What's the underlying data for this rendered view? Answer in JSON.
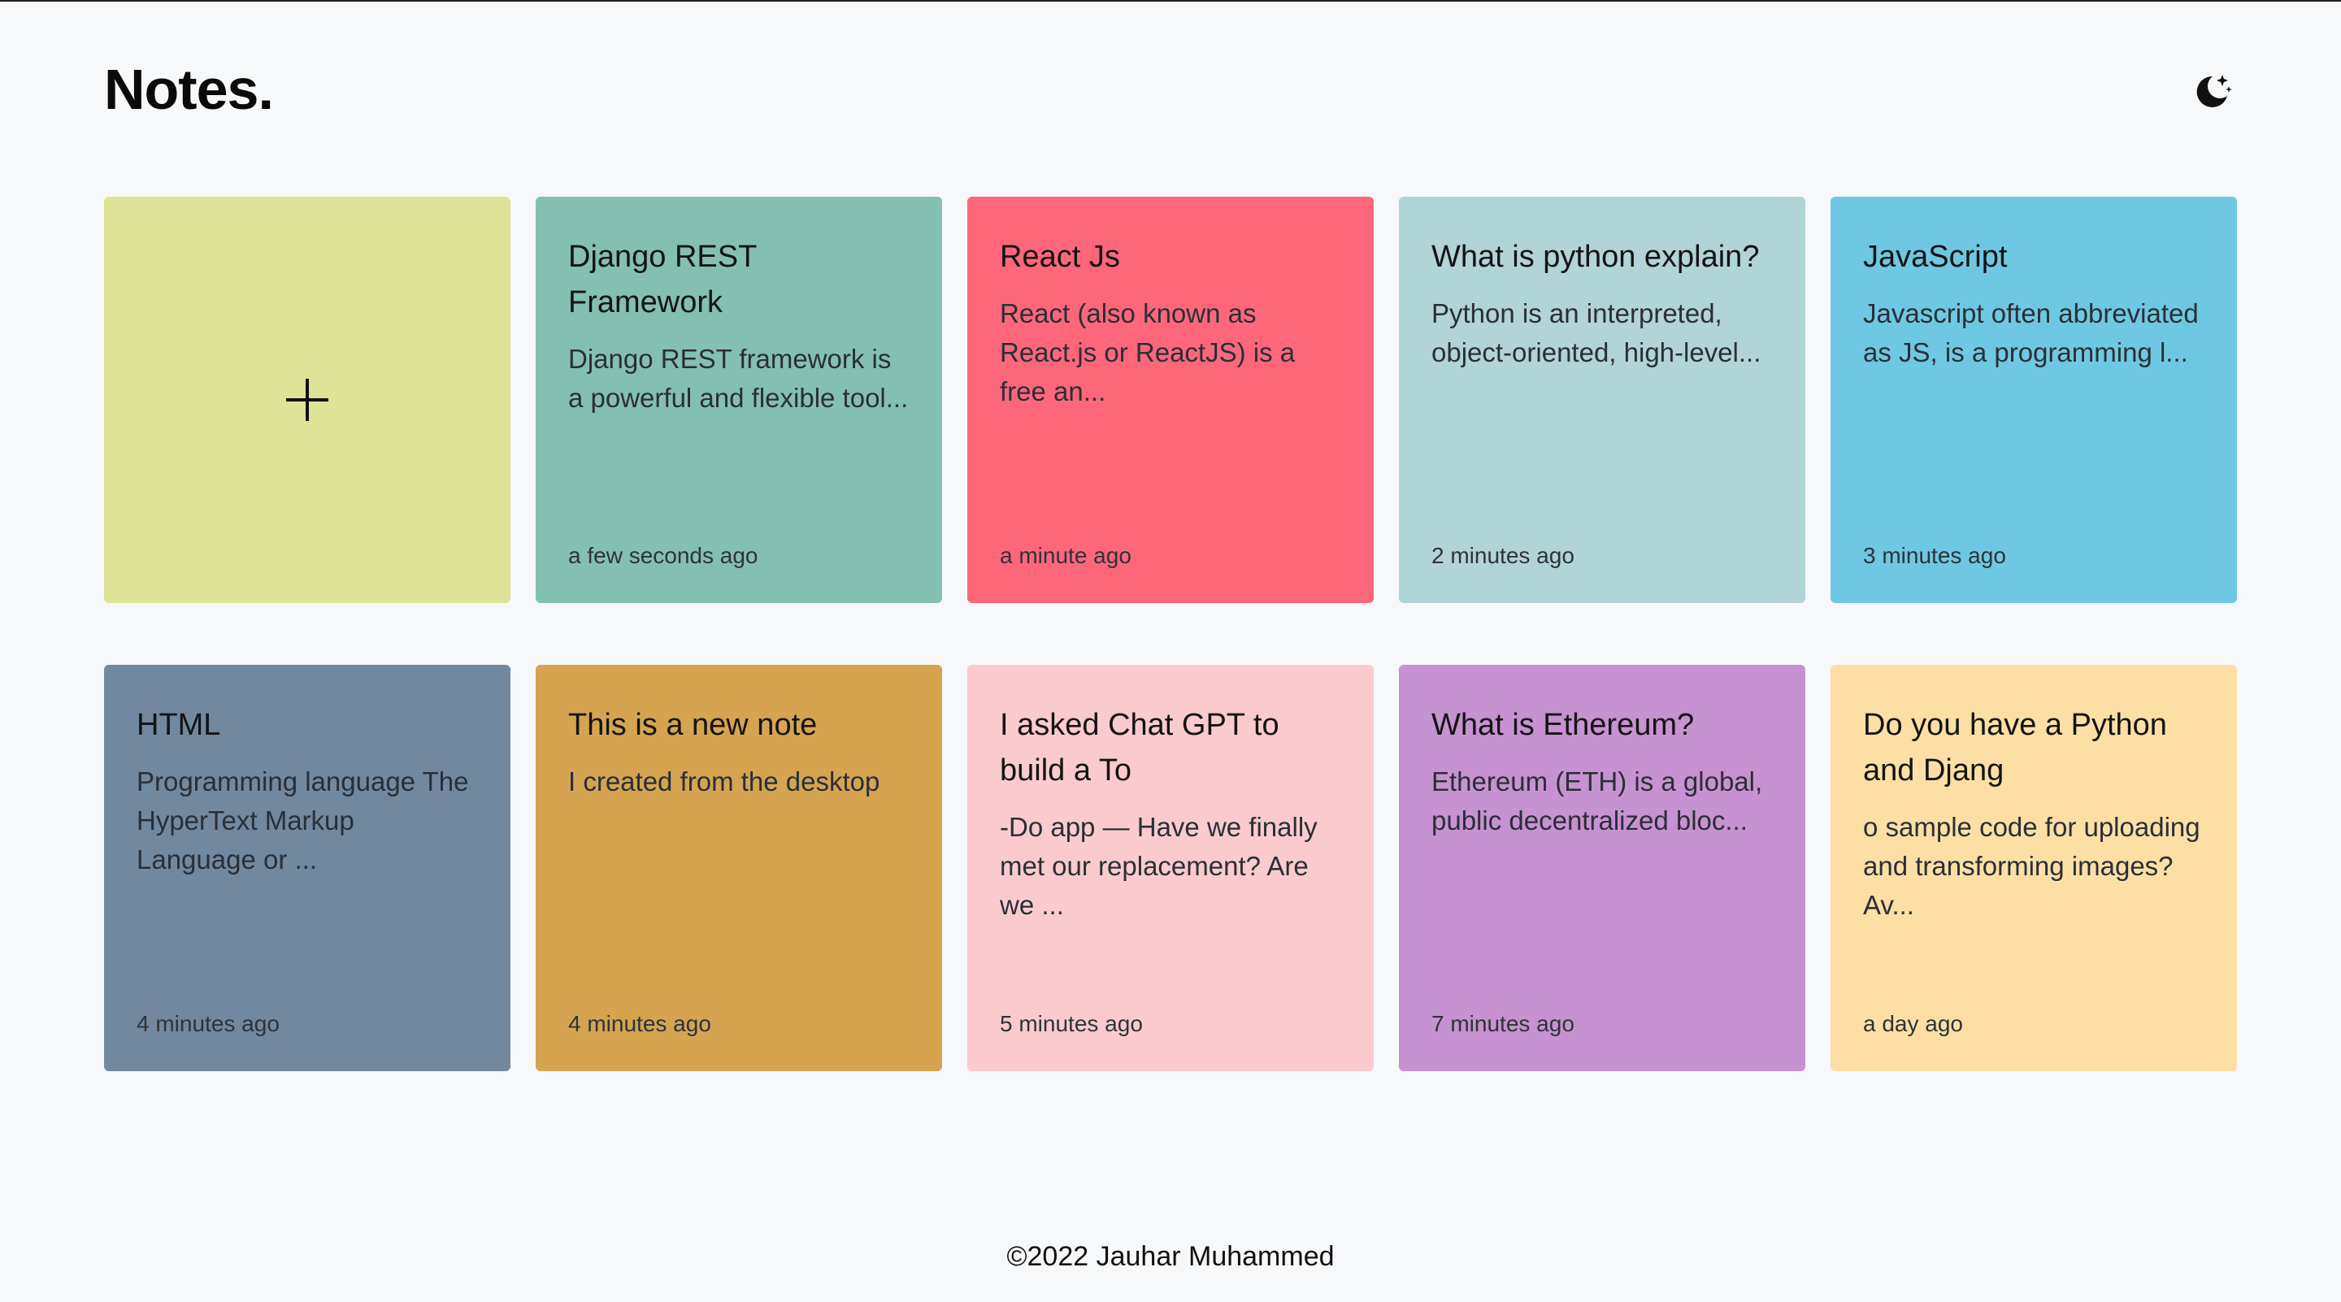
{
  "app": {
    "title": "Notes.",
    "theme_toggle_icon": "moon-stars-icon"
  },
  "add_card": {
    "icon": "plus-icon",
    "color": "#dee397"
  },
  "notes": [
    {
      "title": "Django REST Framework",
      "body": "Django REST framework is a powerful and flexible tool...",
      "time": "a few seconds ago",
      "color": "#83c0b2"
    },
    {
      "title": "React Js",
      "body": "React (also known as React.js or ReactJS) is a free an...",
      "time": "a minute ago",
      "color": "#fe6779"
    },
    {
      "title": "What is python explain?",
      "body": "Python is an interpreted, object-oriented, high-level...",
      "time": "2 minutes ago",
      "color": "#b1d4d6"
    },
    {
      "title": "JavaScript",
      "body": "Javascript often abbreviated as JS, is a programming l...",
      "time": "3 minutes ago",
      "color": "#6ec8e3"
    },
    {
      "title": "HTML",
      "body": "Programming language The HyperText Markup Language or ...",
      "time": "4 minutes ago",
      "color": "#72889f"
    },
    {
      "title": "This is a new note",
      "body": "I created from the desktop",
      "time": "4 minutes ago",
      "color": "#d6a450"
    },
    {
      "title": "I asked Chat GPT to build a To",
      "body": "-Do app — Have we finally met our replacement? Are we ...",
      "time": "5 minutes ago",
      "color": "#fbcacf"
    },
    {
      "title": "What is Ethereum?",
      "body": "Ethereum (ETH) is a global, public decentralized bloc...",
      "time": "7 minutes ago",
      "color": "#c792d1"
    },
    {
      "title": "Do you have a Python and Djang",
      "body": "o sample code for uploading and transforming images? Av...",
      "time": "a day ago",
      "color": "#fddfa5"
    }
  ],
  "footer": {
    "text": "©2022 Jauhar Muhammed"
  }
}
